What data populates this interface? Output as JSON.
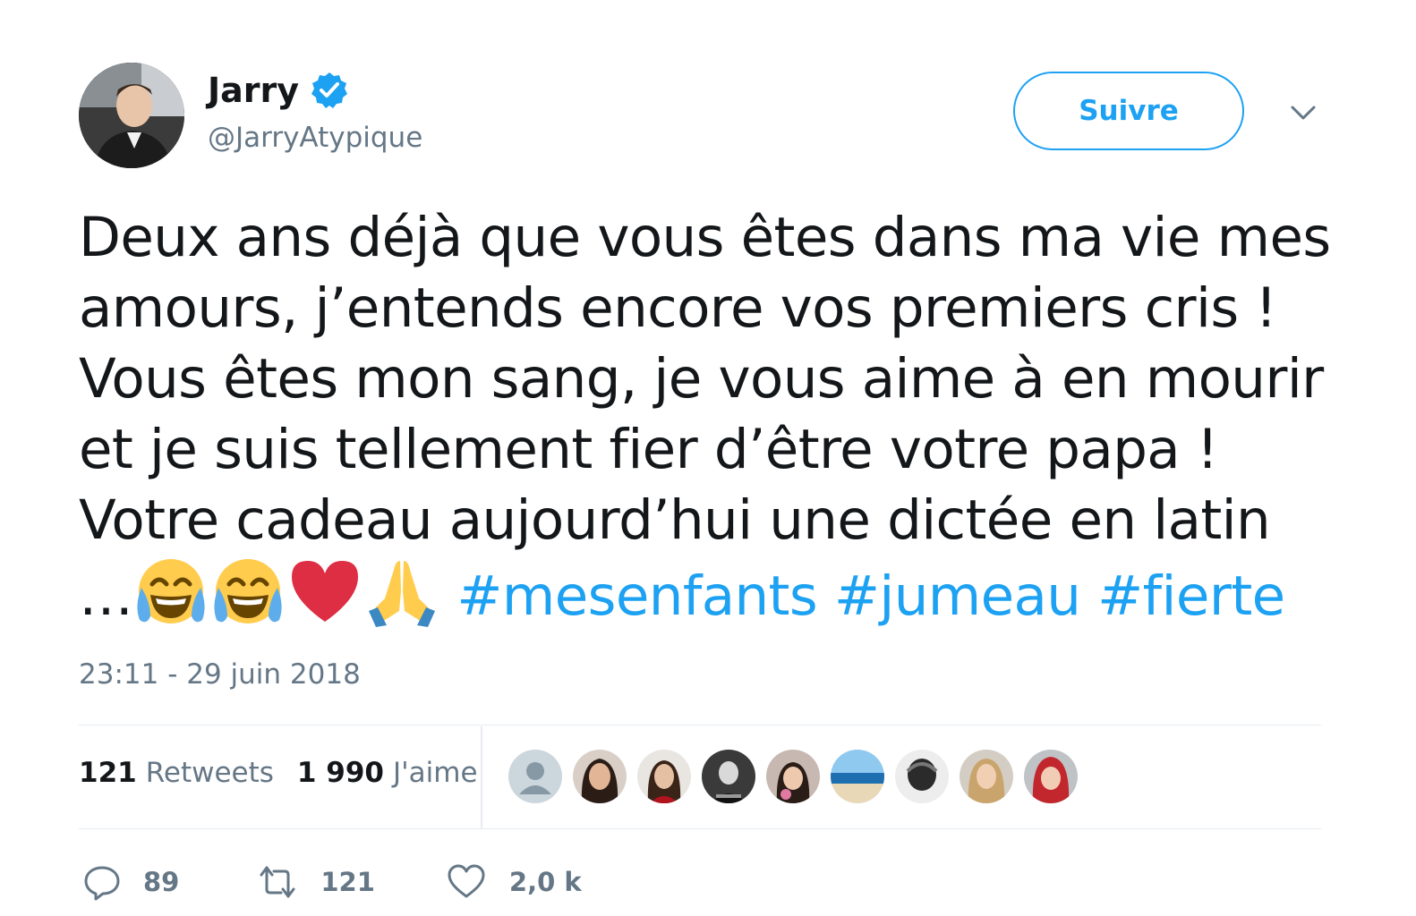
{
  "author": {
    "display_name": "Jarry",
    "handle": "@JarryAtypique",
    "verified": true,
    "avatar_icon": "profile-photo"
  },
  "follow_button_label": "Suivre",
  "menu_icon": "chevron-down-icon",
  "tweet": {
    "lines": [
      "Deux ans déjà que vous êtes dans ma vie mes",
      "amours, j’entends encore vos premiers cris !",
      "Vous êtes mon sang, je vous aime à en mourir",
      "et je suis tellement fier d’être votre papa !",
      "Votre cadeau aujourd’hui une dictée en latin"
    ],
    "last_line_prefix": "…",
    "emojis": [
      "face-with-tears-of-joy",
      "face-with-tears-of-joy",
      "red-heart",
      "folded-hands"
    ],
    "hashtags": [
      "#mesenfants",
      "#jumeau",
      "#fierte"
    ],
    "timestamp": "23:11 - 29 juin 2018"
  },
  "stats": {
    "retweets_count": "121",
    "retweets_label": "Retweets",
    "likes_count": "1 990",
    "likes_label": "J'aime"
  },
  "likers": [
    "default-avatar",
    "user-avatar",
    "user-avatar",
    "user-avatar",
    "user-avatar",
    "beach-avatar",
    "user-avatar",
    "user-avatar",
    "user-avatar"
  ],
  "actions": {
    "reply_count": "89",
    "retweet_count": "121",
    "like_count": "2,0 k"
  },
  "colors": {
    "accent": "#1da1f2",
    "text": "#14171a",
    "secondary": "#657786",
    "divider": "#e6ecf0"
  }
}
